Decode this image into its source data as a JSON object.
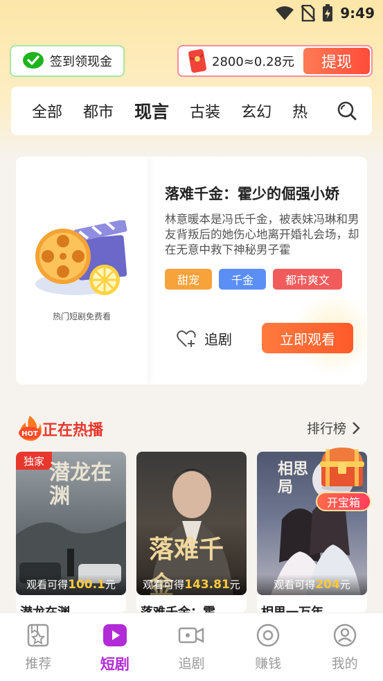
{
  "status_bar": {
    "time": "9:49"
  },
  "header": {
    "signin_label": "签到领现金",
    "coin_text": "2800≈0.28元",
    "withdraw_label": "提现"
  },
  "tabs": [
    "全部",
    "都市",
    "现言",
    "古装",
    "玄幻",
    "热"
  ],
  "active_tab": "现言",
  "featured": {
    "poster_caption": "热门短剧免费看",
    "title": "落难千金：霍少的倔强小娇",
    "description": "林意暖本是冯氏千金，被表妹冯琳和男友背叛后的她伤心地离开婚礼会场，却在无意中救下神秘男子霍",
    "tags": [
      {
        "label": "甜宠",
        "color": "#f7a23a"
      },
      {
        "label": "千金",
        "color": "#5b8ff5"
      },
      {
        "label": "都市爽文",
        "color": "#f25b5b"
      }
    ],
    "follow_label": "追剧",
    "watch_label": "立即观看"
  },
  "hot_section": {
    "badge": "HOT",
    "title": "正在热播",
    "rank_label": "排行榜"
  },
  "dramas": [
    {
      "name": "潜龙在渊",
      "poster_title": "潜龙在渊",
      "badge": "独家",
      "reward_prefix": "观看可得",
      "reward_amount": "100.1",
      "reward_unit": "元"
    },
    {
      "name": "落难千金：霍",
      "poster_title": "落难千金",
      "badge": "",
      "reward_prefix": "观看可得",
      "reward_amount": "143.81",
      "reward_unit": "元"
    },
    {
      "name": "相思一万年",
      "poster_title": "相思局",
      "badge": "",
      "reward_prefix": "观看可得",
      "reward_amount": "204",
      "reward_unit": "元"
    }
  ],
  "treasure_label": "开宝箱",
  "bottom_nav": [
    {
      "label": "推荐",
      "icon": "star-book-icon"
    },
    {
      "label": "短剧",
      "icon": "play-icon"
    },
    {
      "label": "追剧",
      "icon": "video-camera-icon"
    },
    {
      "label": "赚钱",
      "icon": "coin-icon"
    },
    {
      "label": "我的",
      "icon": "user-icon"
    }
  ],
  "active_nav": "短剧",
  "colors": {
    "accent": "#ff5a2a",
    "active_nav": "#b22bd6",
    "hot_red": "#e8372d"
  }
}
